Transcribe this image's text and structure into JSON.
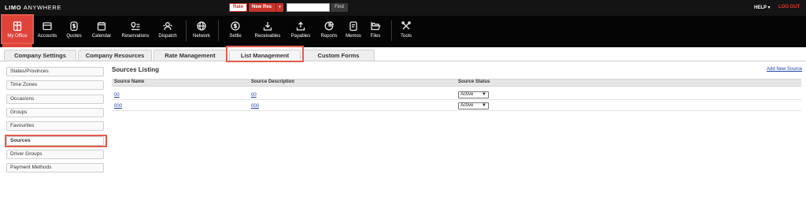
{
  "topbar": {
    "logo_main": "LIMO",
    "logo_sub": "ANYWHERE",
    "rate_label": "Rate",
    "new_res_label": "New Res",
    "new_res_caret": "▾",
    "search_value": "",
    "find_label": "Find",
    "help_label": "HELP ▾",
    "logout_label": "LOG OUT"
  },
  "toolbar": {
    "items": [
      {
        "label": "My Office",
        "icon": "building-icon"
      },
      {
        "label": "Accounts",
        "icon": "folder-icon"
      },
      {
        "label": "Quotes",
        "icon": "dollar-icon"
      },
      {
        "label": "Calendar",
        "icon": "calendar-icon"
      },
      {
        "label": "Reservations",
        "icon": "pin-list-icon"
      },
      {
        "label": "Dispatch",
        "icon": "dispatch-icon"
      },
      {
        "label": "Network",
        "icon": "globe-icon"
      },
      {
        "label": "Settle",
        "icon": "coin-icon"
      },
      {
        "label": "Receivables",
        "icon": "download-icon"
      },
      {
        "label": "Payables",
        "icon": "upload-icon"
      },
      {
        "label": "Reports",
        "icon": "pie-icon"
      },
      {
        "label": "Memos",
        "icon": "memo-icon"
      },
      {
        "label": "Files",
        "icon": "open-folder-icon"
      },
      {
        "label": "Tools",
        "icon": "tools-icon"
      }
    ],
    "active_color": "#e0433a"
  },
  "tabs": [
    {
      "label": "Company Settings"
    },
    {
      "label": "Company Resources"
    },
    {
      "label": "Rate Management"
    },
    {
      "label": "List Management"
    },
    {
      "label": "Custom Forms"
    }
  ],
  "sidebar": {
    "items": [
      {
        "label": "States/Provinces"
      },
      {
        "label": "Time Zones"
      },
      {
        "label": "Occasions"
      },
      {
        "label": "Groups"
      },
      {
        "label": "Favourites"
      },
      {
        "label": "Sources"
      },
      {
        "label": "Driver Groups"
      },
      {
        "label": "Payment Methods"
      }
    ]
  },
  "main": {
    "title": "Sources Listing",
    "add_link": "Add New Source",
    "columns": [
      "Source Name",
      "Source Description",
      "Source Status"
    ],
    "rows": [
      {
        "name": "00",
        "description": "00",
        "status": "Active"
      },
      {
        "name": "000",
        "description": "000",
        "status": "Active"
      }
    ]
  },
  "colors": {
    "highlight": "#e45a4d",
    "link": "#2244aa",
    "topbar_bg": "#141414",
    "toolbar_bg": "#050505"
  }
}
